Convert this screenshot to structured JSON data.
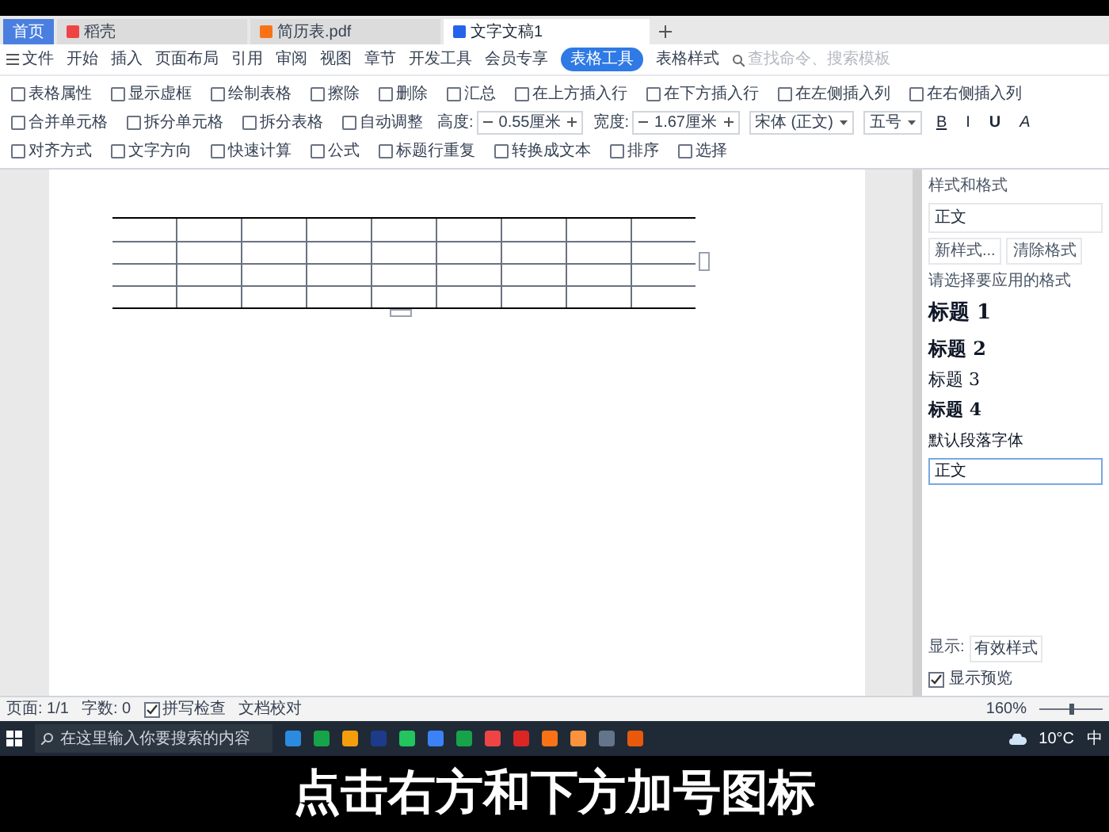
{
  "doc_tabs": [
    {
      "label": "首页",
      "selected": false,
      "kind": "home"
    },
    {
      "label": "稻壳",
      "selected": false,
      "kind": "docer"
    },
    {
      "label": "简历表.pdf",
      "selected": false,
      "kind": "pdf"
    },
    {
      "label": "文字文稿1",
      "selected": true,
      "kind": "doc"
    }
  ],
  "menu": {
    "file": "文件",
    "items": [
      {
        "label": "开始",
        "selected": false
      },
      {
        "label": "插入",
        "selected": false
      },
      {
        "label": "页面布局",
        "selected": false
      },
      {
        "label": "引用",
        "selected": false
      },
      {
        "label": "审阅",
        "selected": false
      },
      {
        "label": "视图",
        "selected": false
      },
      {
        "label": "章节",
        "selected": false
      },
      {
        "label": "开发工具",
        "selected": false
      },
      {
        "label": "会员专享",
        "selected": false
      },
      {
        "label": "表格工具",
        "selected": true
      },
      {
        "label": "表格样式",
        "selected": false
      }
    ],
    "search": {
      "placeholder": "查找命令、搜索模板"
    }
  },
  "ribbon": [
    {
      "label": "表格属性",
      "kind": "button"
    },
    {
      "label": "显示虚框",
      "kind": "button"
    },
    {
      "label": "绘制表格",
      "kind": "button"
    },
    {
      "label": "擦除",
      "kind": "button"
    },
    {
      "label": "删除",
      "kind": "button"
    },
    {
      "label": "汇总",
      "kind": "button"
    },
    {
      "label": "在上方插入行",
      "kind": "button"
    },
    {
      "label": "在下方插入行",
      "kind": "button"
    },
    {
      "label": "在左侧插入列",
      "kind": "button"
    },
    {
      "label": "在右侧插入列",
      "kind": "button"
    },
    {
      "label": "合并单元格",
      "kind": "button"
    },
    {
      "label": "拆分单元格",
      "kind": "button"
    },
    {
      "label": "拆分表格",
      "kind": "button"
    },
    {
      "label": "自动调整",
      "kind": "button"
    },
    {
      "label": "高度:",
      "value": "0.55厘米",
      "kind": "spin"
    },
    {
      "label": "宽度:",
      "value": "1.67厘米",
      "kind": "spin"
    },
    {
      "value": "宋体 (正文)",
      "kind": "select"
    },
    {
      "value": "五号",
      "kind": "select"
    },
    {
      "label": "B",
      "kind": "format"
    },
    {
      "label": "I",
      "kind": "format"
    },
    {
      "label": "U",
      "kind": "format"
    },
    {
      "label": "A",
      "kind": "format"
    },
    {
      "label": "对齐方式",
      "kind": "button"
    },
    {
      "label": "文字方向",
      "kind": "button"
    },
    {
      "label": "快速计算",
      "kind": "button"
    },
    {
      "label": "公式",
      "kind": "button"
    },
    {
      "label": "标题行重复",
      "kind": "button"
    },
    {
      "label": "转换成文本",
      "kind": "button"
    },
    {
      "label": "排序",
      "kind": "button"
    },
    {
      "label": "选择",
      "kind": "button"
    }
  ],
  "styles_pane": {
    "title": "样式和格式",
    "current": "正文",
    "buttons": [
      "新样式...",
      "清除格式"
    ],
    "prompt": "请选择要应用的格式",
    "styles": [
      {
        "label": "标题 1",
        "kind": "h1"
      },
      {
        "label": "标题 2",
        "kind": "h2"
      },
      {
        "label": "标题 3",
        "kind": "h3"
      },
      {
        "label": "标题 4",
        "kind": "h4"
      },
      {
        "label": "默认段落字体",
        "kind": "plain"
      },
      {
        "label": "正文",
        "kind": "boxed"
      }
    ],
    "show_label": "显示:",
    "show_value": "有效样式",
    "preview": {
      "label": "显示预览",
      "checked": true
    }
  },
  "status_bar": {
    "page": "页面: 1/1",
    "words": "字数: 0",
    "spell": {
      "label": "拼写检查",
      "checked": true
    },
    "proofread": "文档校对",
    "zoom": "160%",
    "zoom_slider": {
      "level": 0.5
    }
  },
  "taskbar": {
    "search_placeholder": "在这里输入你要搜索的内容",
    "weather": "10°C",
    "ime": "中"
  },
  "caption": "点击右方和下方加号图标"
}
